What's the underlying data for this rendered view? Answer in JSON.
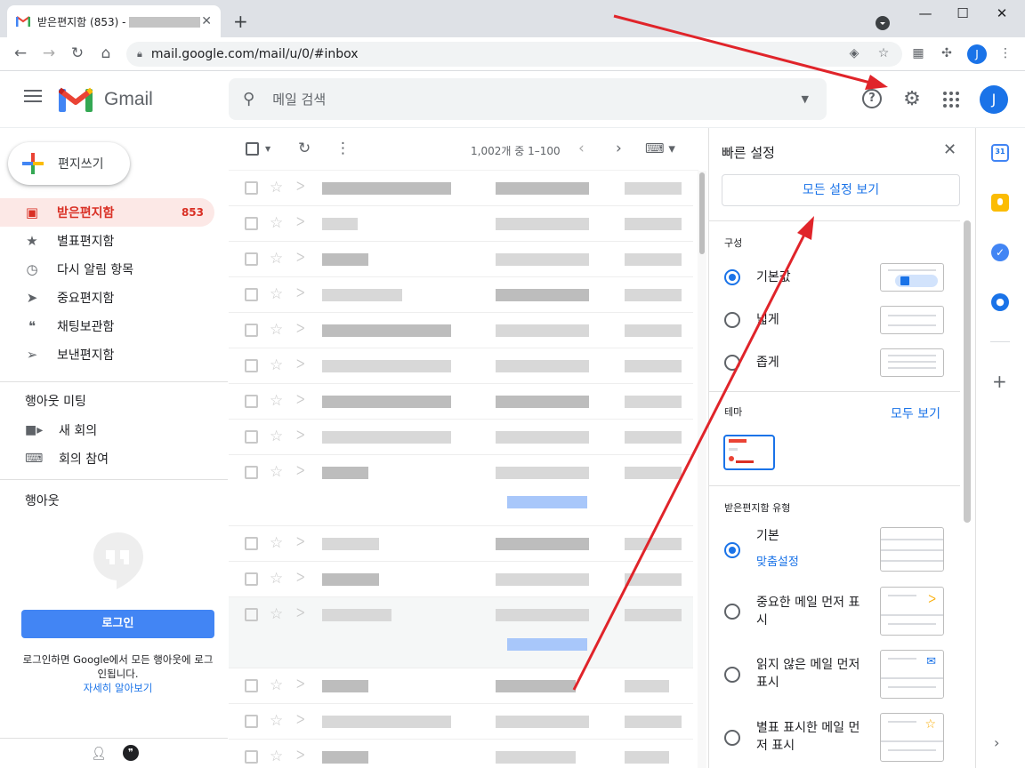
{
  "browser": {
    "tab_title": "받은편지함 (853) -",
    "url": "mail.google.com/mail/u/0/#inbox",
    "profile_initial": "J"
  },
  "gmail": {
    "product_name": "Gmail",
    "search_placeholder": "메일 검색",
    "avatar_initial": "J"
  },
  "sidebar": {
    "compose_label": "편지쓰기",
    "items": [
      {
        "label": "받은편지함",
        "count": "853",
        "icon": "inbox-icon",
        "active": true
      },
      {
        "label": "별표편지함",
        "count": "",
        "icon": "star-icon"
      },
      {
        "label": "다시 알림 항목",
        "count": "",
        "icon": "clock-icon"
      },
      {
        "label": "중요편지함",
        "count": "",
        "icon": "important-icon"
      },
      {
        "label": "채팅보관함",
        "count": "",
        "icon": "chat-icon"
      },
      {
        "label": "보낸편지함",
        "count": "",
        "icon": "send-icon"
      }
    ],
    "meet_title": "행아웃 미팅",
    "meet_new": "새 회의",
    "meet_join": "회의 참여",
    "hangouts_title": "행아웃",
    "login_button": "로그인",
    "login_text": "로그인하면 Google에서 모든 행아웃에 로그인됩니다.",
    "learn_more": "자세히 알아보기"
  },
  "maillist": {
    "pagination": "1,002개 중 1–100"
  },
  "quick_settings": {
    "title": "빠른 설정",
    "see_all": "모든 설정 보기",
    "density_title": "구성",
    "density_options": [
      "기본값",
      "넓게",
      "좁게"
    ],
    "theme_title": "테마",
    "theme_see_all": "모두 보기",
    "inbox_type_title": "받은편지함 유형",
    "inbox_default": "기본",
    "inbox_customize": "맞춤설정",
    "inbox_important": "중요한 메일 먼저 표시",
    "inbox_unread": "읽지 않은 메일 먼저 표시",
    "inbox_starred": "별표 표시한 메일 먼저 표시"
  },
  "colors": {
    "accent": "#1a73e8",
    "inbox_active_bg": "#fce8e6",
    "inbox_active_text": "#d93025",
    "annotation_arrow": "#e0242a"
  }
}
